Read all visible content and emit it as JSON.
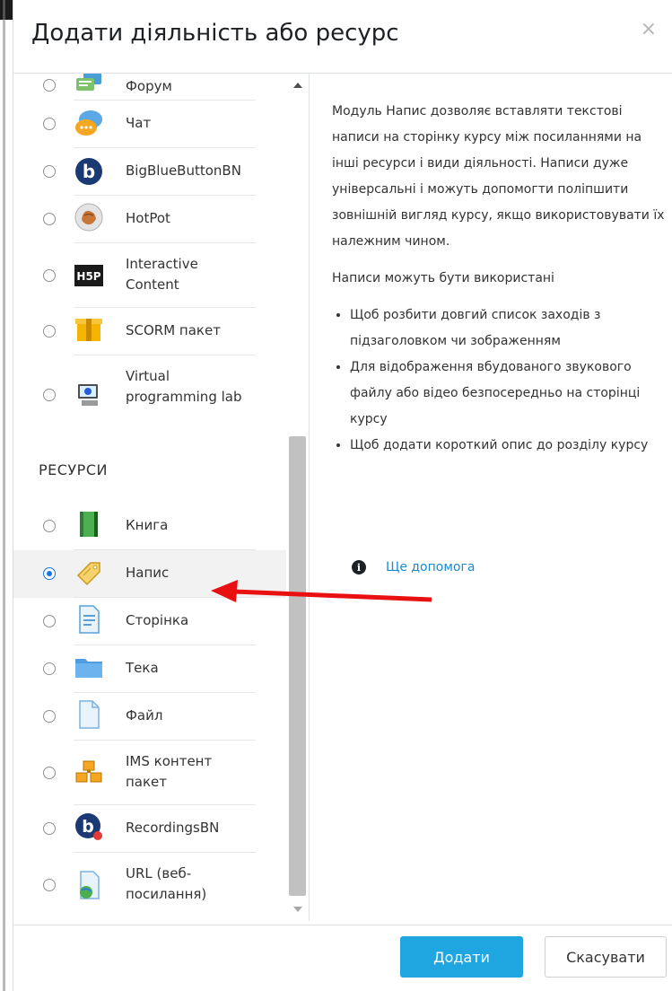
{
  "dialog": {
    "title": "Додати діяльність або ресурс",
    "close": "×"
  },
  "activities": [
    {
      "label": "Форум",
      "icon": "forum-icon",
      "selected": false
    },
    {
      "label": "Чат",
      "icon": "chat-icon",
      "selected": false
    },
    {
      "label": "BigBlueButtonBN",
      "icon": "bigbluebutton-icon",
      "selected": false
    },
    {
      "label": "HotPot",
      "icon": "hotpot-icon",
      "selected": false
    },
    {
      "label": "Interactive Content",
      "icon": "h5p-icon",
      "selected": false
    },
    {
      "label": "SCORM пакет",
      "icon": "scorm-icon",
      "selected": false
    },
    {
      "label": "Virtual programming lab",
      "icon": "vpl-icon",
      "selected": false
    }
  ],
  "resources_heading": "РЕСУРСИ",
  "resources": [
    {
      "label": "Книга",
      "icon": "book-icon",
      "selected": false
    },
    {
      "label": "Напис",
      "icon": "label-tag-icon",
      "selected": true
    },
    {
      "label": "Сторінка",
      "icon": "page-icon",
      "selected": false
    },
    {
      "label": "Тека",
      "icon": "folder-icon",
      "selected": false
    },
    {
      "label": "Файл",
      "icon": "file-icon",
      "selected": false
    },
    {
      "label": "IMS контент пакет",
      "icon": "ims-package-icon",
      "selected": false
    },
    {
      "label": "RecordingsBN",
      "icon": "recordings-icon",
      "selected": false
    },
    {
      "label": "URL (веб-посилання)",
      "icon": "url-icon",
      "selected": false
    }
  ],
  "description": {
    "intro": "Модуль Напис дозволяє вставляти текстові написи на сторінку курсу між посиланнями на інші ресурси і види діяльності. Написи дуже універсальні і можуть допомогти поліпшити зовнішній вигляд курсу, якщо використовувати їх належним чином.",
    "uses_heading": "Написи можуть бути використані",
    "uses": [
      "Щоб розбити довгий список заходів з підзаголовком чи зображенням",
      "Для відображення вбудованого звукового файлу або відео безпосередньо на сторінці курсу",
      "Щоб додати короткий опис до розділу курсу"
    ],
    "more_help": "Ще допомога"
  },
  "footer": {
    "add_label": "Додати",
    "cancel_label": "Скасувати"
  },
  "colors": {
    "primary_button": "#1fa5e0",
    "link": "#1a8bcd",
    "annotation_arrow": "#e81010"
  }
}
